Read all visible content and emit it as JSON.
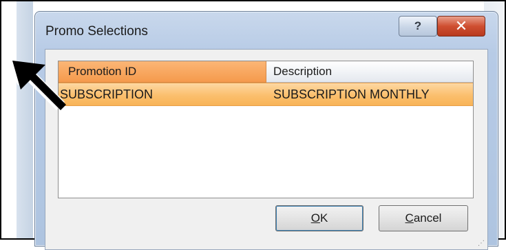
{
  "window": {
    "title": "Promo Selections",
    "help_glyph": "?",
    "close_glyph": "✕"
  },
  "grid": {
    "columns": [
      "Promotion ID",
      "Description"
    ],
    "rows": [
      [
        "SUBSCRIPTION",
        "SUBSCRIPTION MONTHLY"
      ]
    ]
  },
  "buttons": {
    "ok_label": "OK",
    "cancel_label": "Cancel"
  },
  "icons": {
    "arrow": "pointer-arrow-icon",
    "help": "help-icon",
    "close": "close-icon",
    "grip": "resize-grip-icon"
  },
  "colors": {
    "selected_row": "#fbbf6d",
    "active_header": "#f59a4c",
    "close_button": "#cf4f31"
  }
}
